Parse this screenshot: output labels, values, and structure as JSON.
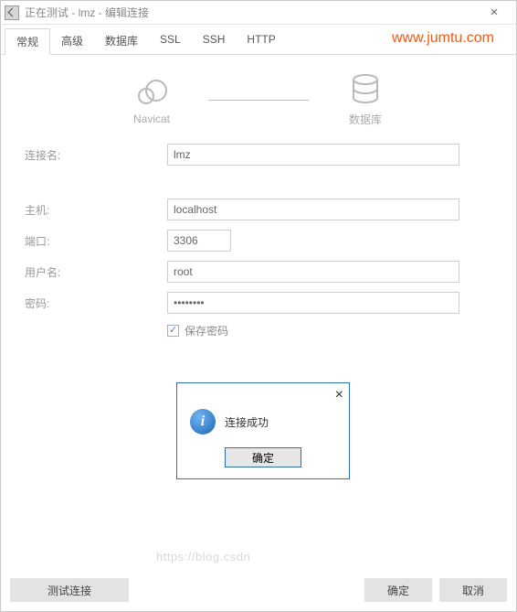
{
  "titlebar": {
    "title": "正在测试 - lmz - 编辑连接",
    "close_glyph": "×"
  },
  "watermark": "www.jumtu.com",
  "bottom_watermark": "https://blog.csdn",
  "tabs": [
    {
      "label": "常规",
      "active": true
    },
    {
      "label": "高级",
      "active": false
    },
    {
      "label": "数据库",
      "active": false
    },
    {
      "label": "SSL",
      "active": false
    },
    {
      "label": "SSH",
      "active": false
    },
    {
      "label": "HTTP",
      "active": false
    }
  ],
  "diagram": {
    "left_label": "Navicat",
    "right_label": "数据库"
  },
  "form": {
    "connection_name": {
      "label": "连接名:",
      "value": "lmz"
    },
    "host": {
      "label": "主机:",
      "value": "localhost"
    },
    "port": {
      "label": "端口:",
      "value": "3306"
    },
    "user": {
      "label": "用户名:",
      "value": "root"
    },
    "password": {
      "label": "密码:",
      "value": "••••••••"
    },
    "save_password": {
      "label": "保存密码",
      "checked": true
    }
  },
  "modal": {
    "close_glyph": "×",
    "info_glyph": "i",
    "message": "连接成功",
    "ok_label": "确定"
  },
  "buttons": {
    "test": "测试连接",
    "ok": "确定",
    "cancel": "取消"
  }
}
